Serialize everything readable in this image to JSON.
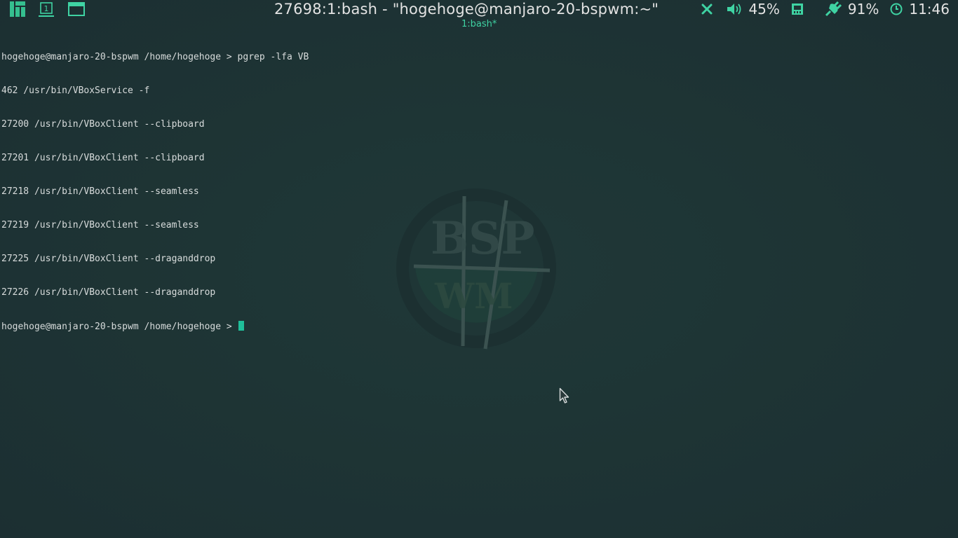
{
  "topbar": {
    "window_title": "27698:1:bash - \"hogehoge@manjaro-20-bspwm:~\"",
    "volume": "45%",
    "battery": "91%",
    "clock": "11:46",
    "icons": {
      "launcher": "manjaro-logo-icon",
      "workspace": "workspace-1-icon",
      "window": "window-icon",
      "close": "close-icon",
      "volume": "speaker-icon",
      "memory": "memory-icon",
      "power": "plug-icon",
      "clock": "clock-icon"
    },
    "accent_color": "#3fd3a3"
  },
  "tmux": {
    "tab_label": "1:bash*"
  },
  "terminal": {
    "prompt": "hogehoge@manjaro-20-bspwm /home/hogehoge > ",
    "command": "pgrep -lfa VB",
    "output": [
      "462 /usr/bin/VBoxService -f",
      "27200 /usr/bin/VBoxClient --clipboard",
      "27201 /usr/bin/VBoxClient --clipboard",
      "27218 /usr/bin/VBoxClient --seamless",
      "27219 /usr/bin/VBoxClient --seamless",
      "27225 /usr/bin/VBoxClient --draganddrop",
      "27226 /usr/bin/VBoxClient --draganddrop"
    ],
    "current_prompt": "hogehoge@manjaro-20-bspwm /home/hogehoge > ",
    "cursor_color": "#1fbf9a"
  },
  "wallpaper": {
    "logo_text_top": "BSP",
    "logo_text_bottom": "WM"
  }
}
